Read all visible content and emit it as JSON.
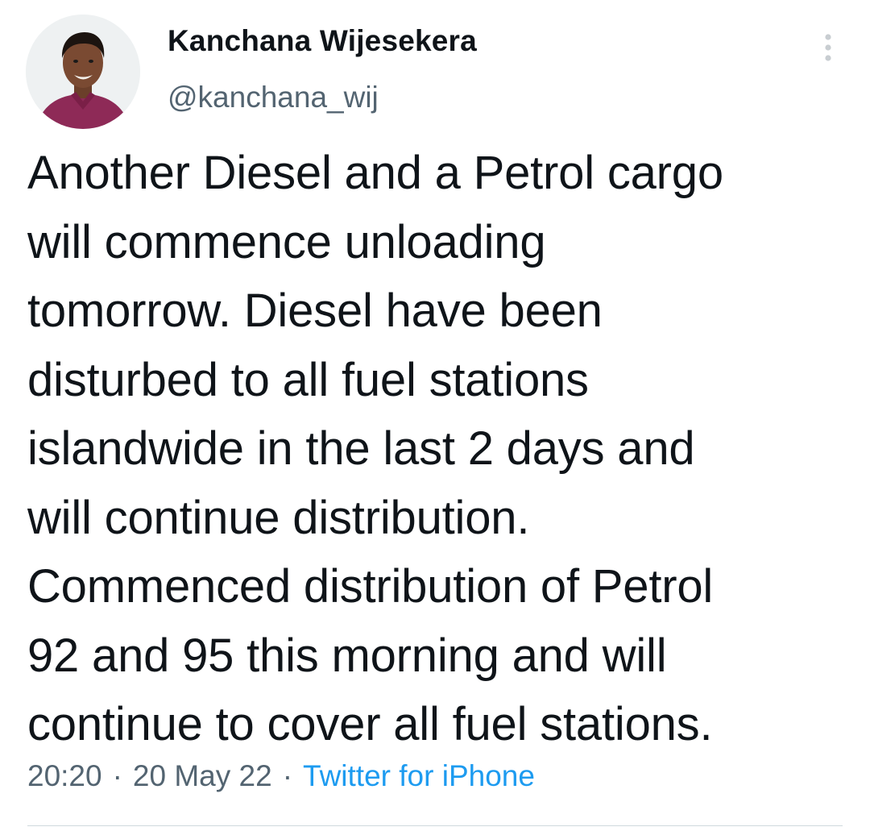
{
  "tweet": {
    "author": {
      "display_name": "Kanchana Wijesekera",
      "handle": "@kanchana_wij",
      "avatar_icon": "profile-photo"
    },
    "more_icon": "more-vertical-icon",
    "text": "Another Diesel and a Petrol cargo\nwill commence unloading\ntomorrow. Diesel have been\ndisturbed to all fuel stations\nislandwide in the last 2 days and\nwill continue distribution.\nCommenced distribution of Petrol\n92 and 95 this morning and will\ncontinue to cover all fuel stations.",
    "meta": {
      "time": "20:20",
      "date": "20 May 22",
      "source": "Twitter for iPhone",
      "separator": "·"
    }
  },
  "colors": {
    "text_primary": "#0f1419",
    "text_secondary": "#536471",
    "link": "#1d9bf0",
    "divider": "#cfd9de"
  }
}
